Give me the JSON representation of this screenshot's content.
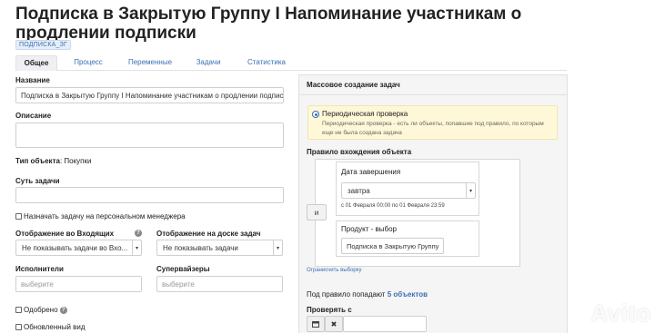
{
  "header": {
    "title": "Подписка в Закрытую Группу I Напоминание участникам о продлении подписки",
    "tag": "ПОДПИСКА_ЗГ"
  },
  "tabs": [
    {
      "label": "Общее"
    },
    {
      "label": "Процесс"
    },
    {
      "label": "Переменные"
    },
    {
      "label": "Задачи"
    },
    {
      "label": "Статистика"
    }
  ],
  "form": {
    "name_label": "Название",
    "name_value": "Подписка в Закрытую Группу I Напоминание участникам о продлении подписки",
    "description_label": "Описание",
    "description_value": "",
    "object_type_label": "Тип объекта",
    "object_type_value": ": Покупки",
    "essence_label": "Суть задачи",
    "essence_value": "",
    "assign_manager_label": "Назначать задачу на персональном менеджера",
    "inbox_display_label": "Отображение во Входящих",
    "inbox_display_value": "Не показывать задачи во Вхо...",
    "board_display_label": "Отображение на доске задач",
    "board_display_value": "Не показывать задачи",
    "executors_label": "Исполнители",
    "executors_placeholder": "выберите",
    "supervisors_label": "Супервайзеры",
    "supervisors_placeholder": "выберите",
    "approved_label": "Одобрено",
    "updated_view_label": "Обновленный вид"
  },
  "panel": {
    "title": "Массовое создание задач",
    "periodic_label": "Периодическая проверка",
    "periodic_desc": "Периодическая проверка - есть ли объекты, попавшие под правило, по которым еще не была создана задача",
    "rule_label": "Правило вхождения объекта",
    "and_button": "и",
    "end_date_label": "Дата завершения",
    "end_date_value": "завтра",
    "date_range": "с 01 Февраля 00:00 по 01 Февраля 23:59",
    "product_label": "Продукт - выбор",
    "product_value": "Подписка в Закрытую Группу",
    "clear_link": "Огранисчить выборку",
    "matching_prefix": "Под правило попадают",
    "matching_count": "5 объектов",
    "check_from_label": "Проверять с"
  },
  "icons": {
    "help": "question-circle-icon",
    "caret": "chevron-down-icon",
    "calendar": "calendar-icon",
    "clear": "close-icon"
  },
  "watermark": "Avito",
  "colors": {
    "accent": "#3a6fb5",
    "notice_bg": "#fff8d8",
    "panel_bg": "#f5f5f5"
  }
}
